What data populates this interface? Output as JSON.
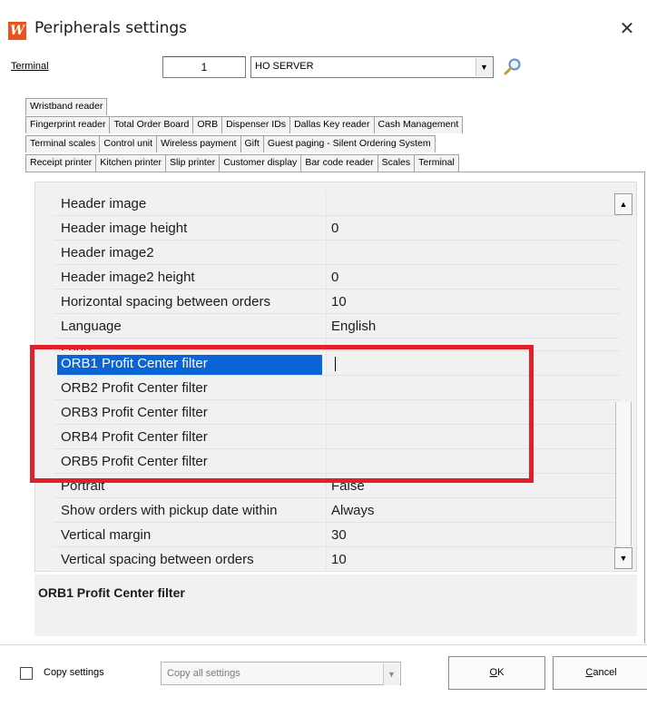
{
  "window": {
    "app_icon_letter": "W",
    "title": "Peripherals settings",
    "close_glyph": "✕"
  },
  "terminal": {
    "label": "Terminal",
    "number": "1",
    "selected": "HO SERVER"
  },
  "tabs": {
    "row1": [
      "Wristband reader"
    ],
    "row2": [
      "Fingerprint reader",
      "Total Order Board",
      "ORB",
      "Dispenser IDs",
      "Dallas Key reader",
      "Cash Management"
    ],
    "row3": [
      "Terminal scales",
      "Control unit",
      "Wireless payment",
      "Gift",
      "Guest paging - Silent Ordering System"
    ],
    "row4": [
      "Receipt printer",
      "Kitchen printer",
      "Slip printer",
      "Customer display",
      "Bar code reader",
      "Scales",
      "Terminal"
    ]
  },
  "properties": [
    {
      "name": "Header image",
      "value": ""
    },
    {
      "name": "Header image height",
      "value": "0"
    },
    {
      "name": "Header image2",
      "value": ""
    },
    {
      "name": "Header image2 height",
      "value": "0"
    },
    {
      "name": "Horizontal spacing between orders",
      "value": "10"
    },
    {
      "name": "Language",
      "value": "English"
    },
    {
      "name": "Logo",
      "value": ""
    },
    {
      "name": "ORB1 Profit Center filter",
      "value": ""
    },
    {
      "name": "ORB2 Profit Center filter",
      "value": ""
    },
    {
      "name": "ORB3 Profit Center filter",
      "value": ""
    },
    {
      "name": "ORB4 Profit Center filter",
      "value": ""
    },
    {
      "name": "ORB5 Profit Center filter",
      "value": ""
    },
    {
      "name": "Portrait",
      "value": "False"
    },
    {
      "name": "Show orders with pickup date within",
      "value": "Always"
    },
    {
      "name": "Vertical margin",
      "value": "30"
    },
    {
      "name": "Vertical spacing between orders",
      "value": "10"
    }
  ],
  "description": {
    "title": "ORB1 Profit Center filter"
  },
  "bottom": {
    "copy_settings_label": "Copy settings",
    "copy_select_value": "Copy all settings",
    "ok_label": "OK",
    "cancel_label": "Cancel"
  },
  "colors": {
    "selection": "#0a64d6",
    "highlight": "#e0212c",
    "app_icon": "#e8541c"
  }
}
